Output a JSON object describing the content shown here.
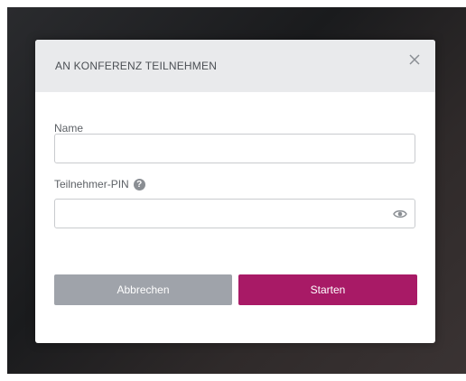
{
  "dialog": {
    "title": "AN KONFERENZ TEILNEHMEN",
    "close_icon": "close-icon"
  },
  "form": {
    "name_label": "Name",
    "name_value": "",
    "pin_label": "Teilnehmer-PIN",
    "pin_value": "",
    "help_icon": "question-circle-icon",
    "visibility_icon": "eye-icon"
  },
  "actions": {
    "cancel_label": "Abbrechen",
    "start_label": "Starten"
  },
  "colors": {
    "accent": "#a81a66",
    "cancel": "#9fa3aa",
    "header_bg": "#e9eaec"
  }
}
